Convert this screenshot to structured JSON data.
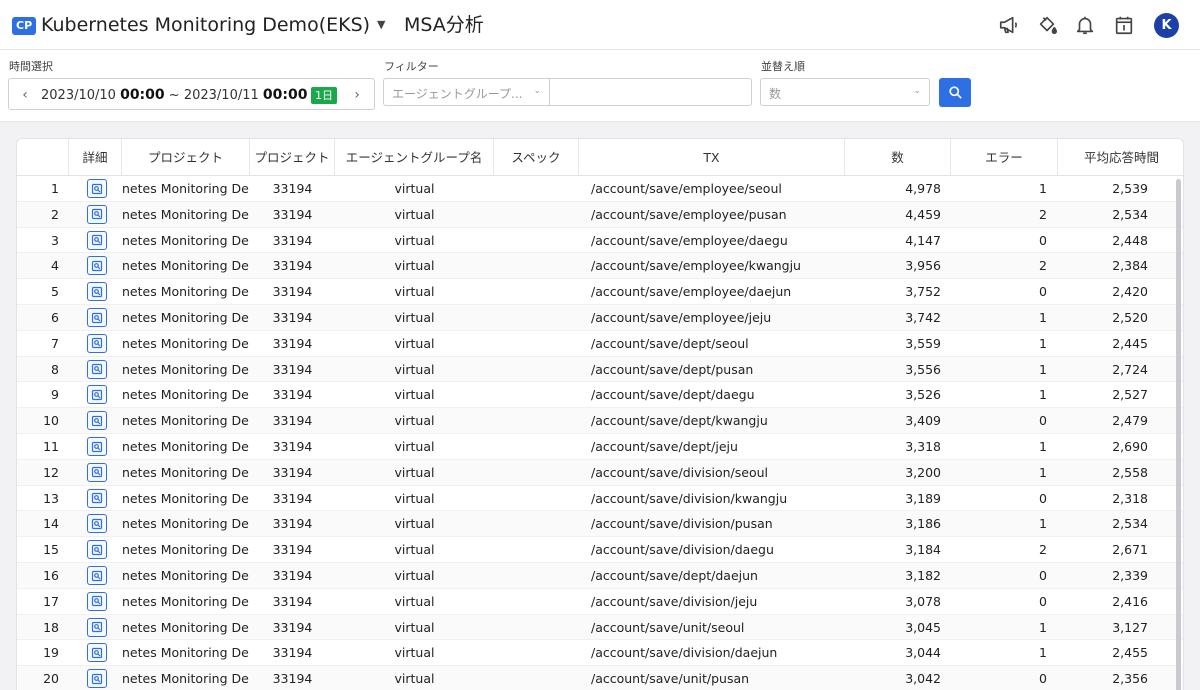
{
  "header": {
    "badge": "CP",
    "project_name": "Kubernetes Monitoring Demo(EKS)",
    "page_title": "MSA分析",
    "avatar_initial": "K",
    "icons": [
      "megaphone-icon",
      "paint-bucket-icon",
      "bell-icon",
      "calendar-icon"
    ],
    "accent_color": "#2f6fe4"
  },
  "toolbar": {
    "time_label": "時間選択",
    "time_start_date": "2023/10/10",
    "time_start_time": "00:00",
    "time_separator": "~",
    "time_end_date": "2023/10/11",
    "time_end_time": "00:00",
    "duration_badge": "1日",
    "filter_label": "フィルター",
    "filter_select_placeholder": "エージェントグループ...",
    "filter_input_value": "",
    "sort_label": "並替え順",
    "sort_placeholder": "数"
  },
  "table": {
    "columns": [
      "",
      "詳細",
      "プロジェクト",
      "プロジェクト",
      "エージェントグループ名",
      "スペック",
      "TX",
      "数",
      "エラー",
      "平均応答時間"
    ],
    "rows": [
      {
        "no": "1",
        "project": "netes Monitoring Demo",
        "code": "33194",
        "group": "virtual",
        "spec": "",
        "tx": "/account/save/employee/seoul",
        "count": "4,978",
        "error": "1",
        "avg": "2,539"
      },
      {
        "no": "2",
        "project": "netes Monitoring Demo",
        "code": "33194",
        "group": "virtual",
        "spec": "",
        "tx": "/account/save/employee/pusan",
        "count": "4,459",
        "error": "2",
        "avg": "2,534"
      },
      {
        "no": "3",
        "project": "netes Monitoring Demo",
        "code": "33194",
        "group": "virtual",
        "spec": "",
        "tx": "/account/save/employee/daegu",
        "count": "4,147",
        "error": "0",
        "avg": "2,448"
      },
      {
        "no": "4",
        "project": "netes Monitoring Demo",
        "code": "33194",
        "group": "virtual",
        "spec": "",
        "tx": "/account/save/employee/kwangju",
        "count": "3,956",
        "error": "2",
        "avg": "2,384"
      },
      {
        "no": "5",
        "project": "netes Monitoring Demo",
        "code": "33194",
        "group": "virtual",
        "spec": "",
        "tx": "/account/save/employee/daejun",
        "count": "3,752",
        "error": "0",
        "avg": "2,420"
      },
      {
        "no": "6",
        "project": "netes Monitoring Demo",
        "code": "33194",
        "group": "virtual",
        "spec": "",
        "tx": "/account/save/employee/jeju",
        "count": "3,742",
        "error": "1",
        "avg": "2,520"
      },
      {
        "no": "7",
        "project": "netes Monitoring Demo",
        "code": "33194",
        "group": "virtual",
        "spec": "",
        "tx": "/account/save/dept/seoul",
        "count": "3,559",
        "error": "1",
        "avg": "2,445"
      },
      {
        "no": "8",
        "project": "netes Monitoring Demo",
        "code": "33194",
        "group": "virtual",
        "spec": "",
        "tx": "/account/save/dept/pusan",
        "count": "3,556",
        "error": "1",
        "avg": "2,724"
      },
      {
        "no": "9",
        "project": "netes Monitoring Demo",
        "code": "33194",
        "group": "virtual",
        "spec": "",
        "tx": "/account/save/dept/daegu",
        "count": "3,526",
        "error": "1",
        "avg": "2,527"
      },
      {
        "no": "10",
        "project": "netes Monitoring Demo",
        "code": "33194",
        "group": "virtual",
        "spec": "",
        "tx": "/account/save/dept/kwangju",
        "count": "3,409",
        "error": "0",
        "avg": "2,479"
      },
      {
        "no": "11",
        "project": "netes Monitoring Demo",
        "code": "33194",
        "group": "virtual",
        "spec": "",
        "tx": "/account/save/dept/jeju",
        "count": "3,318",
        "error": "1",
        "avg": "2,690"
      },
      {
        "no": "12",
        "project": "netes Monitoring Demo",
        "code": "33194",
        "group": "virtual",
        "spec": "",
        "tx": "/account/save/division/seoul",
        "count": "3,200",
        "error": "1",
        "avg": "2,558"
      },
      {
        "no": "13",
        "project": "netes Monitoring Demo",
        "code": "33194",
        "group": "virtual",
        "spec": "",
        "tx": "/account/save/division/kwangju",
        "count": "3,189",
        "error": "0",
        "avg": "2,318"
      },
      {
        "no": "14",
        "project": "netes Monitoring Demo",
        "code": "33194",
        "group": "virtual",
        "spec": "",
        "tx": "/account/save/division/pusan",
        "count": "3,186",
        "error": "1",
        "avg": "2,534"
      },
      {
        "no": "15",
        "project": "netes Monitoring Demo",
        "code": "33194",
        "group": "virtual",
        "spec": "",
        "tx": "/account/save/division/daegu",
        "count": "3,184",
        "error": "2",
        "avg": "2,671"
      },
      {
        "no": "16",
        "project": "netes Monitoring Demo",
        "code": "33194",
        "group": "virtual",
        "spec": "",
        "tx": "/account/save/dept/daejun",
        "count": "3,182",
        "error": "0",
        "avg": "2,339"
      },
      {
        "no": "17",
        "project": "netes Monitoring Demo",
        "code": "33194",
        "group": "virtual",
        "spec": "",
        "tx": "/account/save/division/jeju",
        "count": "3,078",
        "error": "0",
        "avg": "2,416"
      },
      {
        "no": "18",
        "project": "netes Monitoring Demo",
        "code": "33194",
        "group": "virtual",
        "spec": "",
        "tx": "/account/save/unit/seoul",
        "count": "3,045",
        "error": "1",
        "avg": "3,127"
      },
      {
        "no": "19",
        "project": "netes Monitoring Demo",
        "code": "33194",
        "group": "virtual",
        "spec": "",
        "tx": "/account/save/division/daejun",
        "count": "3,044",
        "error": "1",
        "avg": "2,455"
      },
      {
        "no": "20",
        "project": "netes Monitoring Demo",
        "code": "33194",
        "group": "virtual",
        "spec": "",
        "tx": "/account/save/unit/pusan",
        "count": "3,042",
        "error": "0",
        "avg": "2,356"
      }
    ]
  }
}
